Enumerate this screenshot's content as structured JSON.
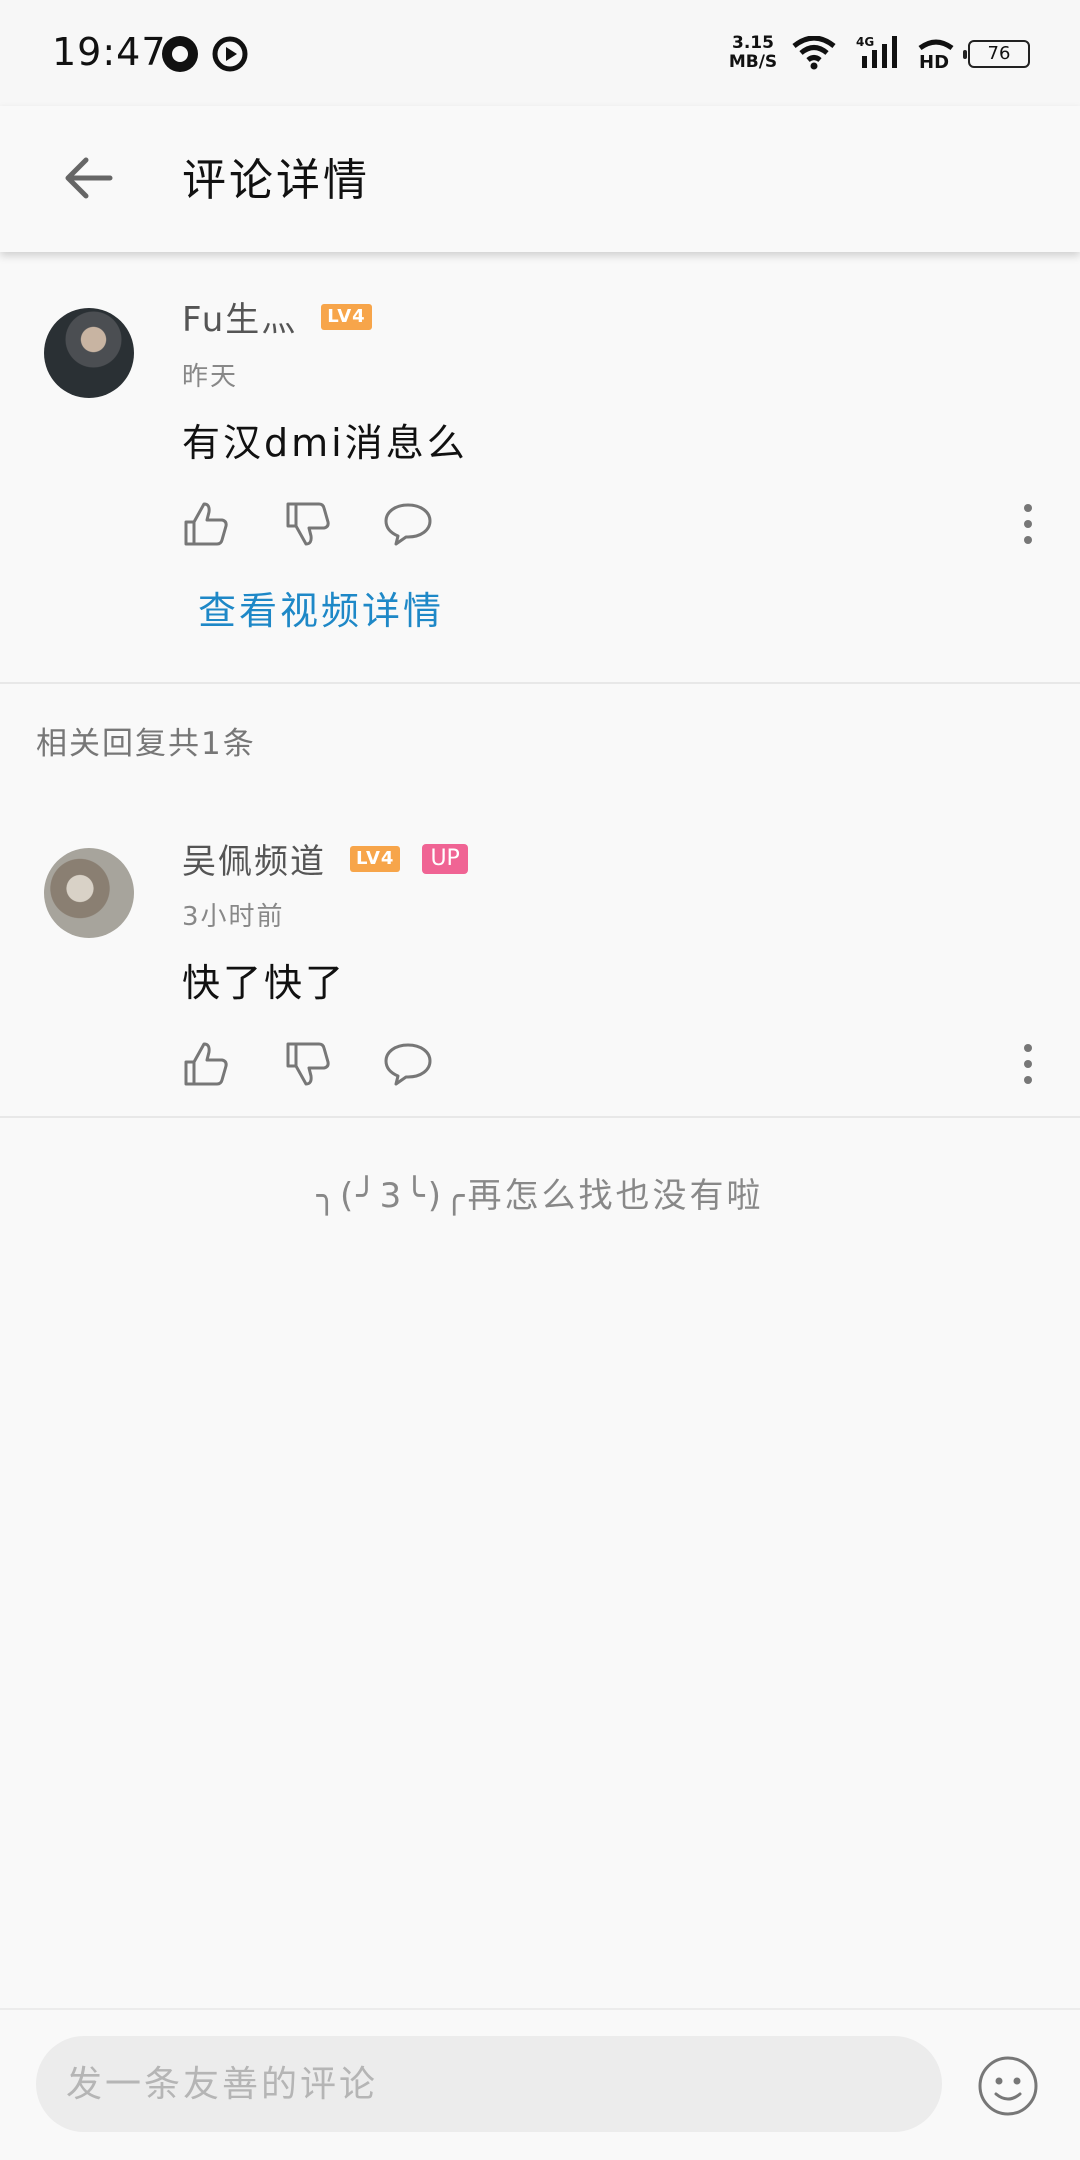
{
  "status_bar": {
    "time": "19:47",
    "net_speed_value": "3.15",
    "net_speed_unit": "MB/S",
    "network_type": "4G",
    "hd": "HD",
    "battery": "76"
  },
  "header": {
    "title": "评论详情"
  },
  "main_comment": {
    "username": "Fu生灬",
    "level": "LV4",
    "time": "昨天",
    "text": "有汉dmi消息么",
    "video_link": "查看视频详情"
  },
  "replies_section": {
    "label": "相关回复共1条"
  },
  "replies": [
    {
      "username": "吴佩频道",
      "level": "LV4",
      "badge": "UP",
      "time": "3小时前",
      "text": "快了快了"
    }
  ],
  "end_message": "╮(╯3╰)╭再怎么找也没有啦",
  "input": {
    "placeholder": "发一条友善的评论"
  },
  "colors": {
    "link": "#1e88c7",
    "level_badge": "#f7a54a",
    "up_badge": "#f06494"
  },
  "icons": [
    "back-arrow-icon",
    "like-icon",
    "dislike-icon",
    "reply-icon",
    "more-icon",
    "emoji-icon"
  ]
}
